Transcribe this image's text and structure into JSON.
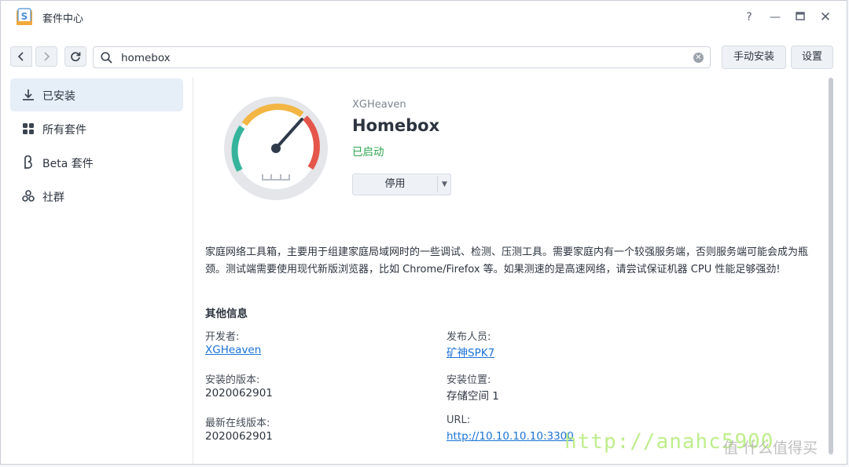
{
  "window": {
    "title": "套件中心",
    "controls": {
      "help": "?",
      "minimize": "—",
      "maximize": "▭",
      "close": "✕"
    }
  },
  "toolbar": {
    "search_value": "homebox",
    "manual_install_label": "手动安装",
    "settings_label": "设置"
  },
  "sidebar": {
    "items": [
      {
        "label": "已安装",
        "icon": "download-icon",
        "active": true
      },
      {
        "label": "所有套件",
        "icon": "grid-icon",
        "active": false
      },
      {
        "label": "Beta 套件",
        "icon": "beta-icon",
        "active": false
      },
      {
        "label": "社群",
        "icon": "community-icon",
        "active": false
      }
    ]
  },
  "package": {
    "vendor": "XGHeaven",
    "name": "Homebox",
    "status": "已启动",
    "stop_label": "停用",
    "description": "家庭网络工具箱，主要用于组建家庭局域网时的一些调试、检测、压测工具。需要家庭内有一个较强服务端，否则服务端可能会成为瓶颈。测试端需要使用现代新版浏览器，比如 Chrome/Firefox 等。如果测速的是高速网络，请尝试保证机器 CPU 性能足够强劲!"
  },
  "info": {
    "section_title": "其他信息",
    "developer_label": "开发者:",
    "developer_value": "XGHeaven",
    "publisher_label": "发布人员:",
    "publisher_value": "矿神SPK7",
    "installed_version_label": "安装的版本:",
    "installed_version_value": "2020062901",
    "location_label": "安装位置:",
    "location_value": "存储空间 1",
    "latest_version_label": "最新在线版本:",
    "latest_version_value": "2020062901",
    "url_label": "URL:",
    "url_value": "http://10.10.10.10:3300"
  },
  "watermark": {
    "text": "http://anahc5900",
    "secondary": "值 什么值得买"
  },
  "colors": {
    "accent": "#1a73d8",
    "status_green": "#2ea44f",
    "active_bg": "#e6eef8"
  }
}
